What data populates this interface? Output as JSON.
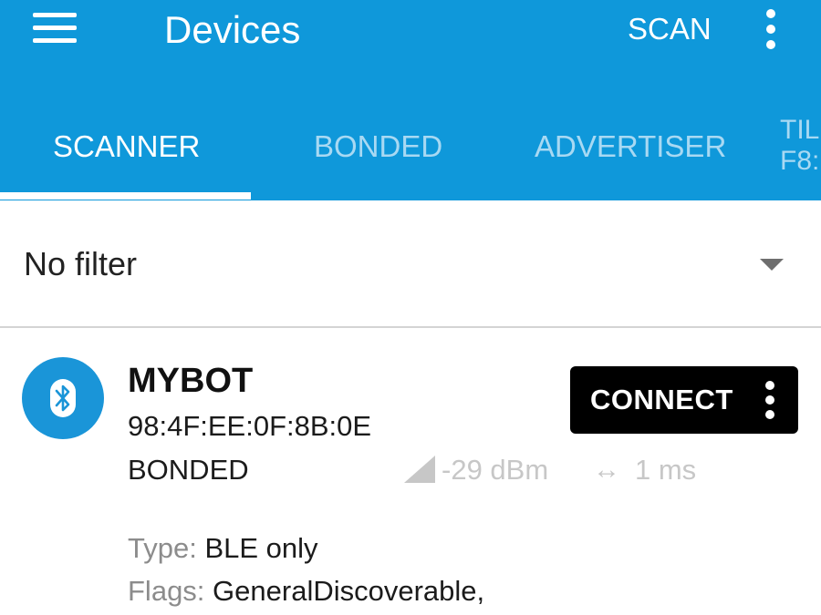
{
  "appbar": {
    "title": "Devices",
    "scan_label": "SCAN",
    "background": "#0f98da"
  },
  "tabs": [
    {
      "label": "SCANNER",
      "active": true
    },
    {
      "label": "BONDED",
      "active": false
    },
    {
      "label": "ADVERTISER",
      "active": false
    }
  ],
  "partial_tab": {
    "line1": "TIL",
    "line2": "F8:("
  },
  "filter": {
    "label": "No filter"
  },
  "device": {
    "name": "MYBOT",
    "address": "98:4F:EE:0F:8B:0E",
    "status": "BONDED",
    "connect_label": "CONNECT",
    "rssi": "-29 dBm",
    "interval": "1 ms",
    "type_label": "Type:",
    "type_value": "BLE only",
    "flags_label": "Flags:",
    "flags_value": "GeneralDiscoverable,"
  },
  "icons": {
    "menu": "menu-icon",
    "overflow": "more-vert-icon",
    "dropdown": "dropdown-arrow-icon",
    "device": "bluetooth-icon",
    "signal": "signal-strength-icon",
    "interval": "left-right-arrow-icon"
  }
}
